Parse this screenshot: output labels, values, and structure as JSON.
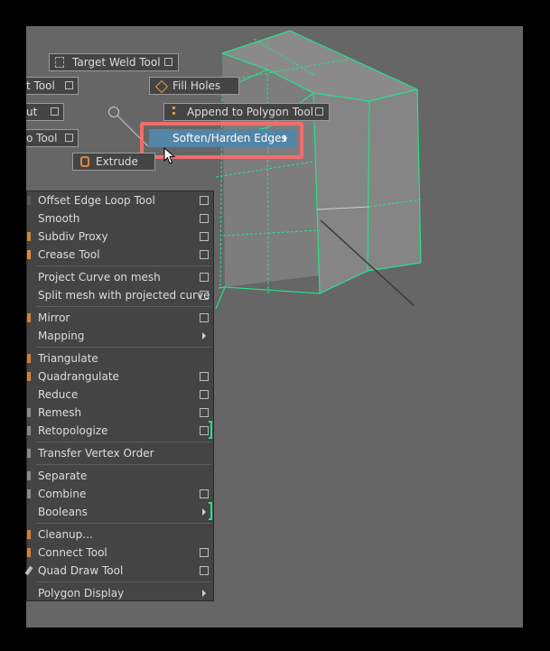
{
  "marking_menu": {
    "target_weld": {
      "label": "Target Weld Tool",
      "icon": "target-weld-icon"
    },
    "fill_holes": {
      "label": "Fill Holes",
      "icon": "fill-holes-icon"
    },
    "multicut_partial": {
      "label": "t Tool"
    },
    "cut_partial": {
      "label": "ut"
    },
    "append_polygon": {
      "label": "Append to Polygon Tool",
      "icon": "append-polygon-icon"
    },
    "soften_harden": {
      "label": "Soften/Harden Edges"
    },
    "tool_partial": {
      "label": "o Tool"
    },
    "extrude": {
      "label": "Extrude",
      "icon": "extrude-icon"
    }
  },
  "polygon_menu": {
    "items": [
      {
        "label": "Offset Edge Loop Tool",
        "option_box": true,
        "submenu": false
      },
      {
        "label": "Smooth",
        "option_box": true,
        "submenu": false
      },
      {
        "label": "Subdiv Proxy",
        "option_box": true,
        "submenu": false
      },
      {
        "label": "Crease Tool",
        "option_box": true,
        "submenu": false
      },
      {
        "label": "Project Curve on mesh",
        "option_box": true,
        "submenu": false
      },
      {
        "label": "Split mesh with projected curve",
        "option_box": true,
        "submenu": false
      },
      {
        "label": "Mirror",
        "option_box": true,
        "submenu": false
      },
      {
        "label": "Mapping",
        "option_box": false,
        "submenu": true
      },
      {
        "label": "Triangulate",
        "option_box": false,
        "submenu": false
      },
      {
        "label": "Quadrangulate",
        "option_box": true,
        "submenu": false
      },
      {
        "label": "Reduce",
        "option_box": true,
        "submenu": false
      },
      {
        "label": "Remesh",
        "option_box": true,
        "submenu": false
      },
      {
        "label": "Retopologize",
        "option_box": true,
        "submenu": false
      },
      {
        "label": "Transfer Vertex Order",
        "option_box": false,
        "submenu": false
      },
      {
        "label": "Separate",
        "option_box": false,
        "submenu": false
      },
      {
        "label": "Combine",
        "option_box": true,
        "submenu": false
      },
      {
        "label": "Booleans",
        "option_box": false,
        "submenu": true
      },
      {
        "label": "Cleanup...",
        "option_box": false,
        "submenu": false
      },
      {
        "label": "Connect Tool",
        "option_box": true,
        "submenu": false
      },
      {
        "label": "Quad Draw Tool",
        "option_box": true,
        "submenu": false
      },
      {
        "label": "Polygon Display",
        "option_box": false,
        "submenu": true
      }
    ]
  },
  "colors": {
    "viewport_bg": "#666666",
    "menu_bg": "#444444",
    "menu_highlight": "#5285a6",
    "wireframe": "#27e08e",
    "callout": "#ee6e6e"
  }
}
